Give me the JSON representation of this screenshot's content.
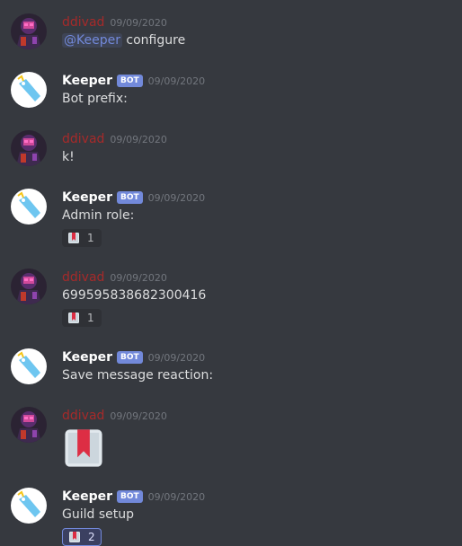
{
  "messages": [
    {
      "author": "ddivad",
      "timestamp": "09/09/2020",
      "mention": "@Keeper",
      "text": "configure"
    },
    {
      "author": "Keeper",
      "bot_tag": "BOT",
      "timestamp": "09/09/2020",
      "text": "Bot prefix:"
    },
    {
      "author": "ddivad",
      "timestamp": "09/09/2020",
      "text": "k!"
    },
    {
      "author": "Keeper",
      "bot_tag": "BOT",
      "timestamp": "09/09/2020",
      "text": "Admin role:",
      "reaction": {
        "emoji": "bookmark",
        "count": "1"
      }
    },
    {
      "author": "ddivad",
      "timestamp": "09/09/2020",
      "text": "699595838682300416",
      "reaction": {
        "emoji": "bookmark",
        "count": "1"
      }
    },
    {
      "author": "Keeper",
      "bot_tag": "BOT",
      "timestamp": "09/09/2020",
      "text": "Save message reaction:"
    },
    {
      "author": "ddivad",
      "timestamp": "09/09/2020",
      "emoji": "bookmark"
    },
    {
      "author": "Keeper",
      "bot_tag": "BOT",
      "timestamp": "09/09/2020",
      "text": "Guild setup",
      "reaction": {
        "emoji": "bookmark",
        "count": "2",
        "active": true
      }
    }
  ],
  "colors": {
    "background": "#36393f",
    "user_name": "#a62a2a",
    "bot_tag": "#7289da",
    "timestamp": "#72767d"
  }
}
